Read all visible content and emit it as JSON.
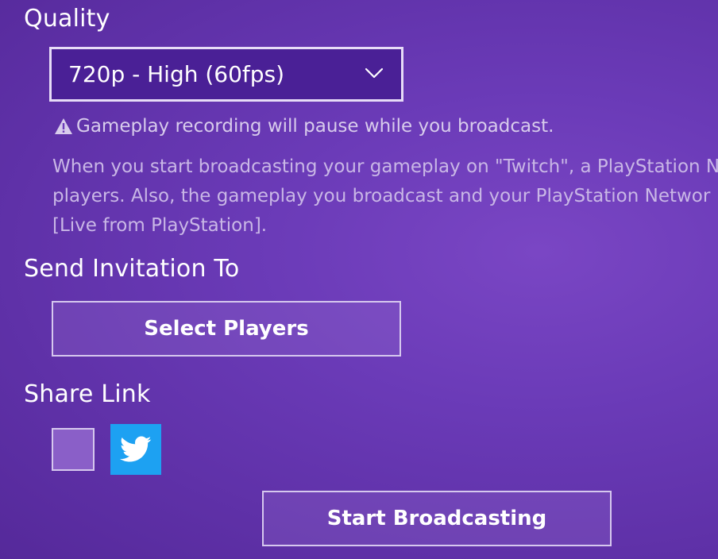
{
  "quality": {
    "heading": "Quality",
    "selected": "720p - High (60fps)"
  },
  "warning_text": "Gameplay recording will pause while you broadcast.",
  "description_lines": [
    "When you start broadcasting your gameplay on \"Twitch\", a PlayStation N",
    "players. Also, the gameplay you broadcast and your PlayStation Networ",
    "[Live from PlayStation]."
  ],
  "invitation": {
    "heading": "Send Invitation To",
    "button_label": "Select Players"
  },
  "share": {
    "heading": "Share Link",
    "checkbox_checked": false,
    "twitter_icon": "twitter-icon"
  },
  "start_button_label": "Start Broadcasting",
  "colors": {
    "background": "#6b3bb8",
    "dropdown_fill": "#4a2096",
    "twitter_blue": "#1da1f2"
  }
}
